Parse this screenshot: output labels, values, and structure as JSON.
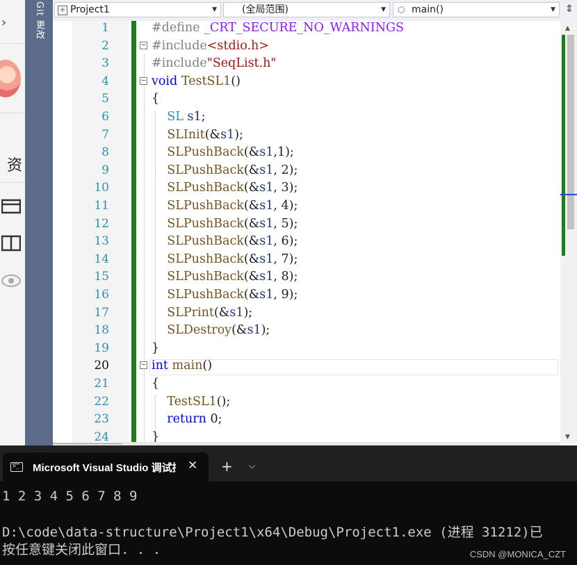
{
  "git_tab": {
    "label": "Git 更改"
  },
  "left_strip": {
    "char": "资"
  },
  "toolbar": {
    "project": "Project1",
    "scope": "(全局范围)",
    "member": "main()"
  },
  "editor": {
    "line_numbers": [
      "1",
      "2",
      "3",
      "4",
      "5",
      "6",
      "7",
      "8",
      "9",
      "10",
      "11",
      "12",
      "13",
      "14",
      "15",
      "16",
      "17",
      "18",
      "19",
      "20",
      "21",
      "22",
      "23",
      "24"
    ],
    "active_line": "20"
  },
  "terminal": {
    "tab_title": "Microsoft Visual Studio 调试控制台",
    "output_line1": "1 2 3 4 5 6 7 8 9",
    "output_line2": "D:\\code\\data-structure\\Project1\\x64\\Debug\\Project1.exe (进程 31212)已",
    "output_line3": "按任意键关闭此窗口. . .",
    "watermark": "CSDN @MONICA_CZT"
  },
  "colors": {
    "keyword": "#0000ff",
    "preprocessor": "#808080",
    "string": "#a31515",
    "function": "#74531f",
    "type": "#2b91af",
    "change_bar": "#1c7e1c"
  }
}
